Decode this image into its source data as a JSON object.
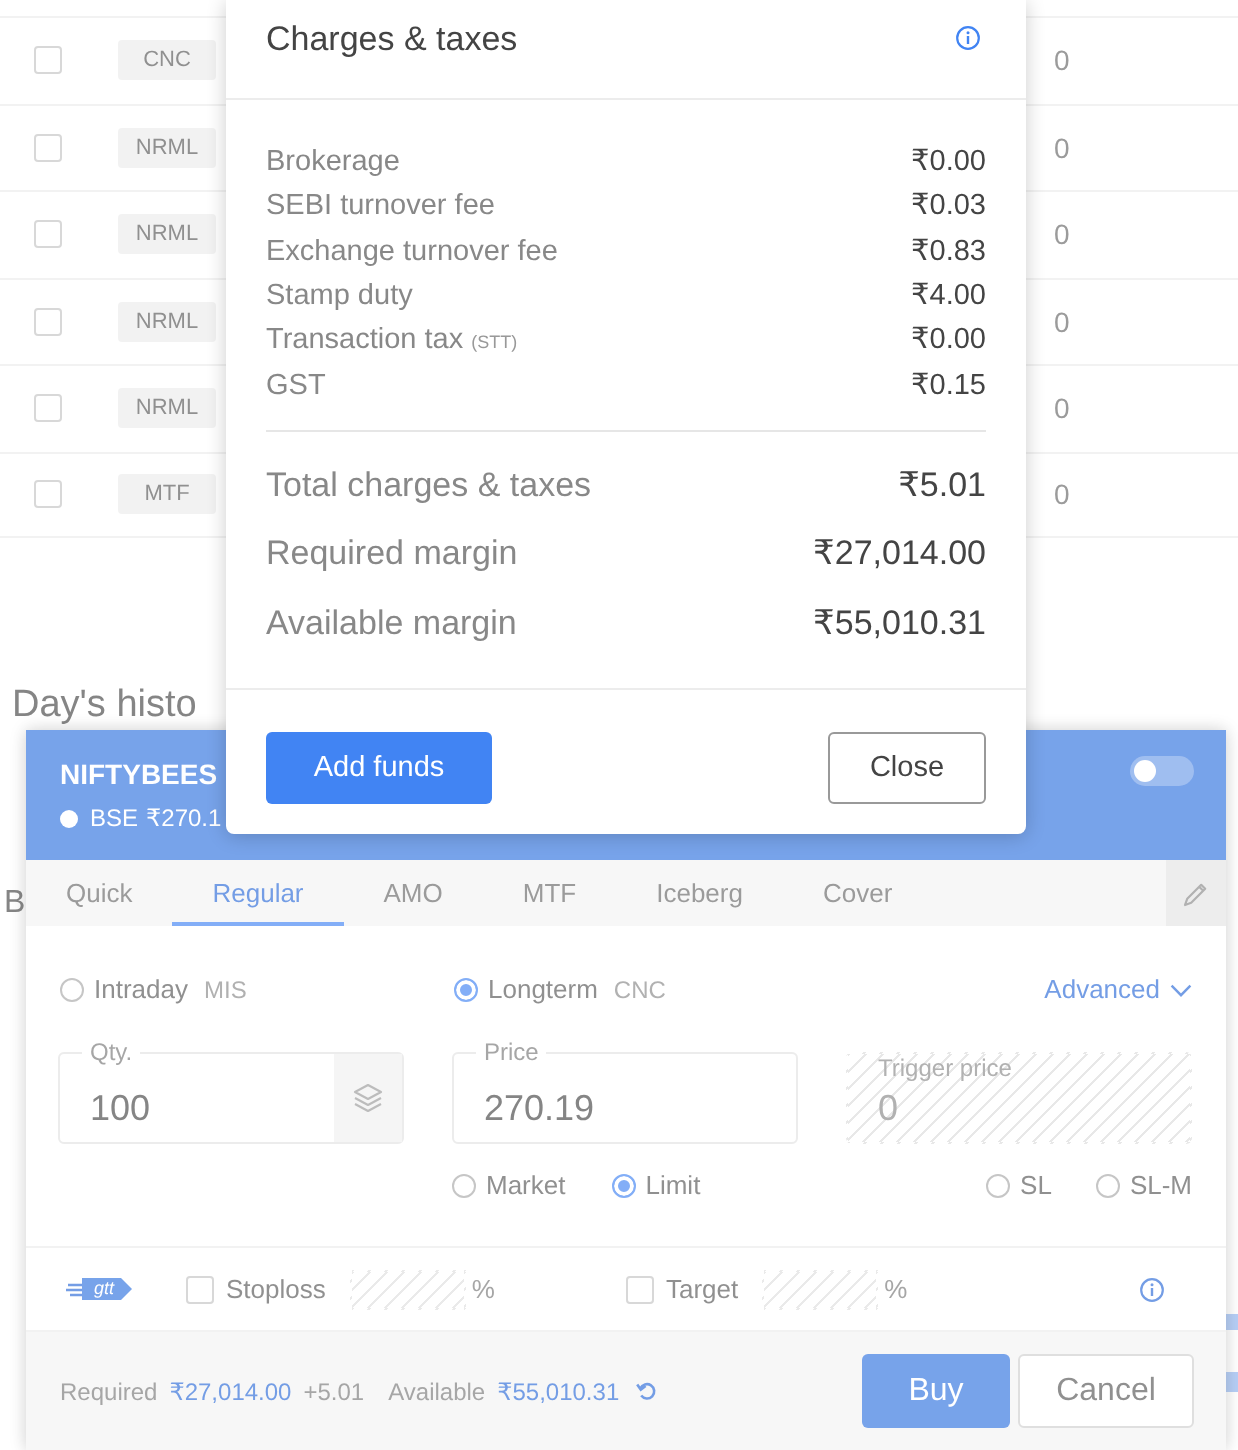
{
  "positions_table": {
    "rows": [
      {
        "checked": false,
        "badge": "CNC",
        "column_3": "0"
      },
      {
        "checked": false,
        "badge": "NRML",
        "column_3": "0"
      },
      {
        "checked": false,
        "badge": "NRML",
        "column_3": "0"
      },
      {
        "checked": false,
        "badge": "NRML",
        "column_3": "0"
      },
      {
        "checked": false,
        "badge": "NRML",
        "column_3": "0"
      },
      {
        "checked": false,
        "badge": "MTF",
        "column_3": "0"
      }
    ]
  },
  "section_headings": [
    "Day's histo",
    "B"
  ],
  "order_window": {
    "symbol": "NIFTYBEES",
    "exchange": "BSE",
    "price": "₹270.1",
    "toggle": {
      "on": false
    },
    "tabs": [
      {
        "label": "Quick",
        "selected": false
      },
      {
        "label": "Regular",
        "selected": true
      },
      {
        "label": "AMO",
        "selected": false
      },
      {
        "label": "MTF",
        "selected": false
      },
      {
        "label": "Iceberg",
        "selected": false
      },
      {
        "label": "Cover",
        "selected": false
      }
    ],
    "product_options": [
      {
        "label": "Intraday",
        "code": "MIS",
        "selected": false
      },
      {
        "label": "Longterm",
        "code": "CNC",
        "selected": true
      }
    ],
    "advanced_link": "Advanced",
    "fields": [
      {
        "kind": "quantity",
        "label": "Qty.",
        "value": "100",
        "disabled": false
      },
      {
        "kind": "plain",
        "label": "Price",
        "value": "270.19",
        "disabled": false
      },
      {
        "kind": "plain",
        "label": "Trigger price",
        "value": "0",
        "disabled": true
      }
    ],
    "order_type_groups": [
      {
        "options": [
          {
            "label": "Market",
            "selected": false
          },
          {
            "label": "Limit",
            "selected": true
          }
        ]
      },
      {
        "options": [
          {
            "label": "SL",
            "selected": false
          },
          {
            "label": "SL-M",
            "selected": false
          }
        ]
      }
    ],
    "gtt_tag": "gtt",
    "gtt_options": [
      {
        "label": "Stoploss",
        "checked": false,
        "unit": "%"
      },
      {
        "label": "Target",
        "checked": false,
        "unit": "%"
      }
    ],
    "footer": {
      "required_label": "Required",
      "required_value": "₹27,014.00",
      "charges": "+5.01",
      "available_label": "Available",
      "available_value": "₹55,010.31"
    },
    "buttons": [
      {
        "kind": "primary",
        "label": "Buy"
      },
      {
        "kind": "secondary",
        "label": "Cancel"
      }
    ]
  },
  "charges_dialog": {
    "title": "Charges & taxes",
    "charges": [
      {
        "label": "Brokerage",
        "value": "₹0.00"
      },
      {
        "label": "SEBI turnover fee",
        "value": "₹0.03"
      },
      {
        "label": "Exchange turnover fee",
        "value": "₹0.83"
      },
      {
        "label": "Stamp duty",
        "value": "₹4.00"
      },
      {
        "label": "Transaction tax",
        "note": "(STT)",
        "value": "₹0.00"
      },
      {
        "label": "GST",
        "value": "₹0.15"
      }
    ],
    "totals": [
      {
        "label": "Total charges & taxes",
        "value": "₹5.01"
      },
      {
        "label": "Required margin",
        "value": "₹27,014.00"
      },
      {
        "label": "Available margin",
        "value": "₹55,010.31"
      }
    ],
    "buttons": [
      {
        "kind": "primary",
        "label": "Add funds"
      },
      {
        "kind": "secondary",
        "label": "Close"
      }
    ]
  }
}
